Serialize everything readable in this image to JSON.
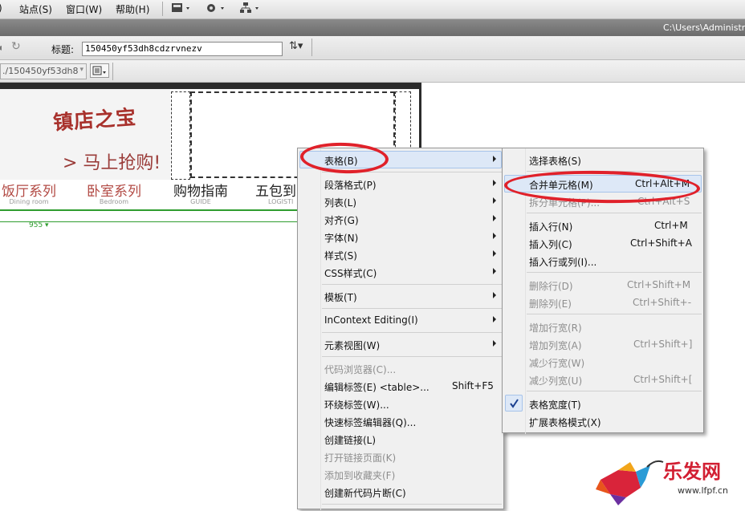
{
  "menubar": {
    "items": [
      "站点(S)",
      "窗口(W)",
      "帮助(H)"
    ],
    "partial_left": ")"
  },
  "pathbar": {
    "path": "C:\\Users\\Administra"
  },
  "doc_toolbar": {
    "title_label": "标题:",
    "title_value": "150450yf53dh8cdzrvnezv"
  },
  "address_bar": {
    "value": "./150450yf53dh8"
  },
  "design": {
    "promo_text": "镇店之宝",
    "buy_text": "> 马上抢购!",
    "nav": [
      {
        "cn": "饭厅系列",
        "en": "Dining room"
      },
      {
        "cn": "卧室系列",
        "en": "Bedroom"
      },
      {
        "cn": "购物指南",
        "en": "GUIDE"
      },
      {
        "cn": "五包到",
        "en": "LOGISTI"
      }
    ],
    "ruler_width": "955"
  },
  "context_menu": {
    "items": [
      {
        "label": "表格(B)",
        "arrow": true
      },
      {
        "label": "段落格式(P)",
        "arrow": true
      },
      {
        "label": "列表(L)",
        "arrow": true
      },
      {
        "label": "对齐(G)",
        "arrow": true
      },
      {
        "label": "字体(N)",
        "arrow": true
      },
      {
        "label": "样式(S)",
        "arrow": true
      },
      {
        "label": "CSS样式(C)",
        "arrow": true
      },
      {
        "label": "模板(T)",
        "arrow": true
      },
      {
        "label": "InContext Editing(I)",
        "arrow": true
      },
      {
        "label": "元素视图(W)",
        "arrow": true
      },
      {
        "label": "代码浏览器(C)...",
        "disabled": true
      },
      {
        "label": "编辑标签(E) <table>...",
        "shortcut": "Shift+F5"
      },
      {
        "label": "环绕标签(W)..."
      },
      {
        "label": "快速标签编辑器(Q)..."
      },
      {
        "label": "创建链接(L)"
      },
      {
        "label": "打开链接页面(K)",
        "disabled": true
      },
      {
        "label": "添加到收藏夹(F)",
        "disabled": true
      },
      {
        "label": "创建新代码片断(C)"
      }
    ]
  },
  "table_submenu": {
    "items": [
      {
        "label": "选择表格(S)"
      },
      {
        "label": "合并单元格(M)",
        "shortcut": "Ctrl+Alt+M"
      },
      {
        "label": "拆分单元格(P)...",
        "shortcut": "Ctrl+Alt+S",
        "disabled": true
      },
      {
        "label": "插入行(N)",
        "shortcut": "Ctrl+M"
      },
      {
        "label": "插入列(C)",
        "shortcut": "Ctrl+Shift+A"
      },
      {
        "label": "插入行或列(I)..."
      },
      {
        "label": "删除行(D)",
        "shortcut": "Ctrl+Shift+M",
        "disabled": true
      },
      {
        "label": "删除列(E)",
        "shortcut": "Ctrl+Shift+-",
        "disabled": true
      },
      {
        "label": "增加行宽(R)",
        "disabled": true
      },
      {
        "label": "增加列宽(A)",
        "shortcut": "Ctrl+Shift+]",
        "disabled": true
      },
      {
        "label": "减少行宽(W)",
        "disabled": true
      },
      {
        "label": "减少列宽(U)",
        "shortcut": "Ctrl+Shift+[",
        "disabled": true
      },
      {
        "label": "表格宽度(T)",
        "checked": true
      },
      {
        "label": "扩展表格模式(X)"
      }
    ]
  },
  "watermark": {
    "brand": "乐发网",
    "url": "www.lfpf.cn"
  },
  "colors": {
    "highlight_ring": "#e0212a",
    "menu_bg": "#f0f0f0",
    "accent_green": "#2f9d2f"
  }
}
